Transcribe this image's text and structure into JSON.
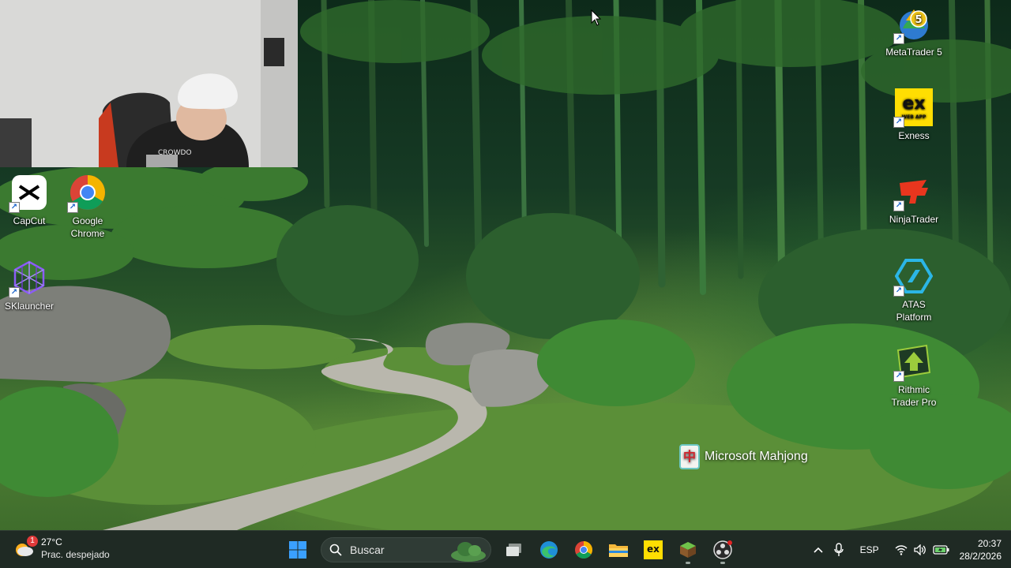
{
  "desktop": {
    "icons_left": [
      {
        "id": "capcut",
        "label": "CapCut"
      },
      {
        "id": "chrome",
        "label": "Google Chrome"
      },
      {
        "id": "sklauncher",
        "label": "SKlauncher"
      }
    ],
    "icons_right": [
      {
        "id": "metatrader5",
        "label": "MetaTrader 5"
      },
      {
        "id": "exness",
        "label": "Exness"
      },
      {
        "id": "ninjatrader",
        "label": "NinjaTrader"
      },
      {
        "id": "atas",
        "label": "ATAS Platform"
      },
      {
        "id": "rithmic",
        "label": "Rithmic Trader Pro"
      }
    ],
    "floating_app": {
      "label": "Microsoft Mahjong"
    },
    "metatrader_badge": "5",
    "exness_logo": "ex",
    "exness_sub": "WEB APP"
  },
  "taskbar": {
    "weather": {
      "temp": "27°C",
      "desc": "Prac. despejado",
      "badge": "1"
    },
    "search": {
      "placeholder": "Buscar"
    },
    "pinned": [
      "start",
      "search",
      "task-view",
      "edge",
      "chrome",
      "file-explorer",
      "exness",
      "minecraft",
      "obs"
    ],
    "tray": {
      "language": "ESP",
      "time": "20:37",
      "date": "28/2/2026"
    },
    "exness_label": "ex"
  },
  "colors": {
    "taskbar_bg": "#1f2a24",
    "accent_blue": "#1a8cff",
    "grass": "#4f7f34"
  }
}
